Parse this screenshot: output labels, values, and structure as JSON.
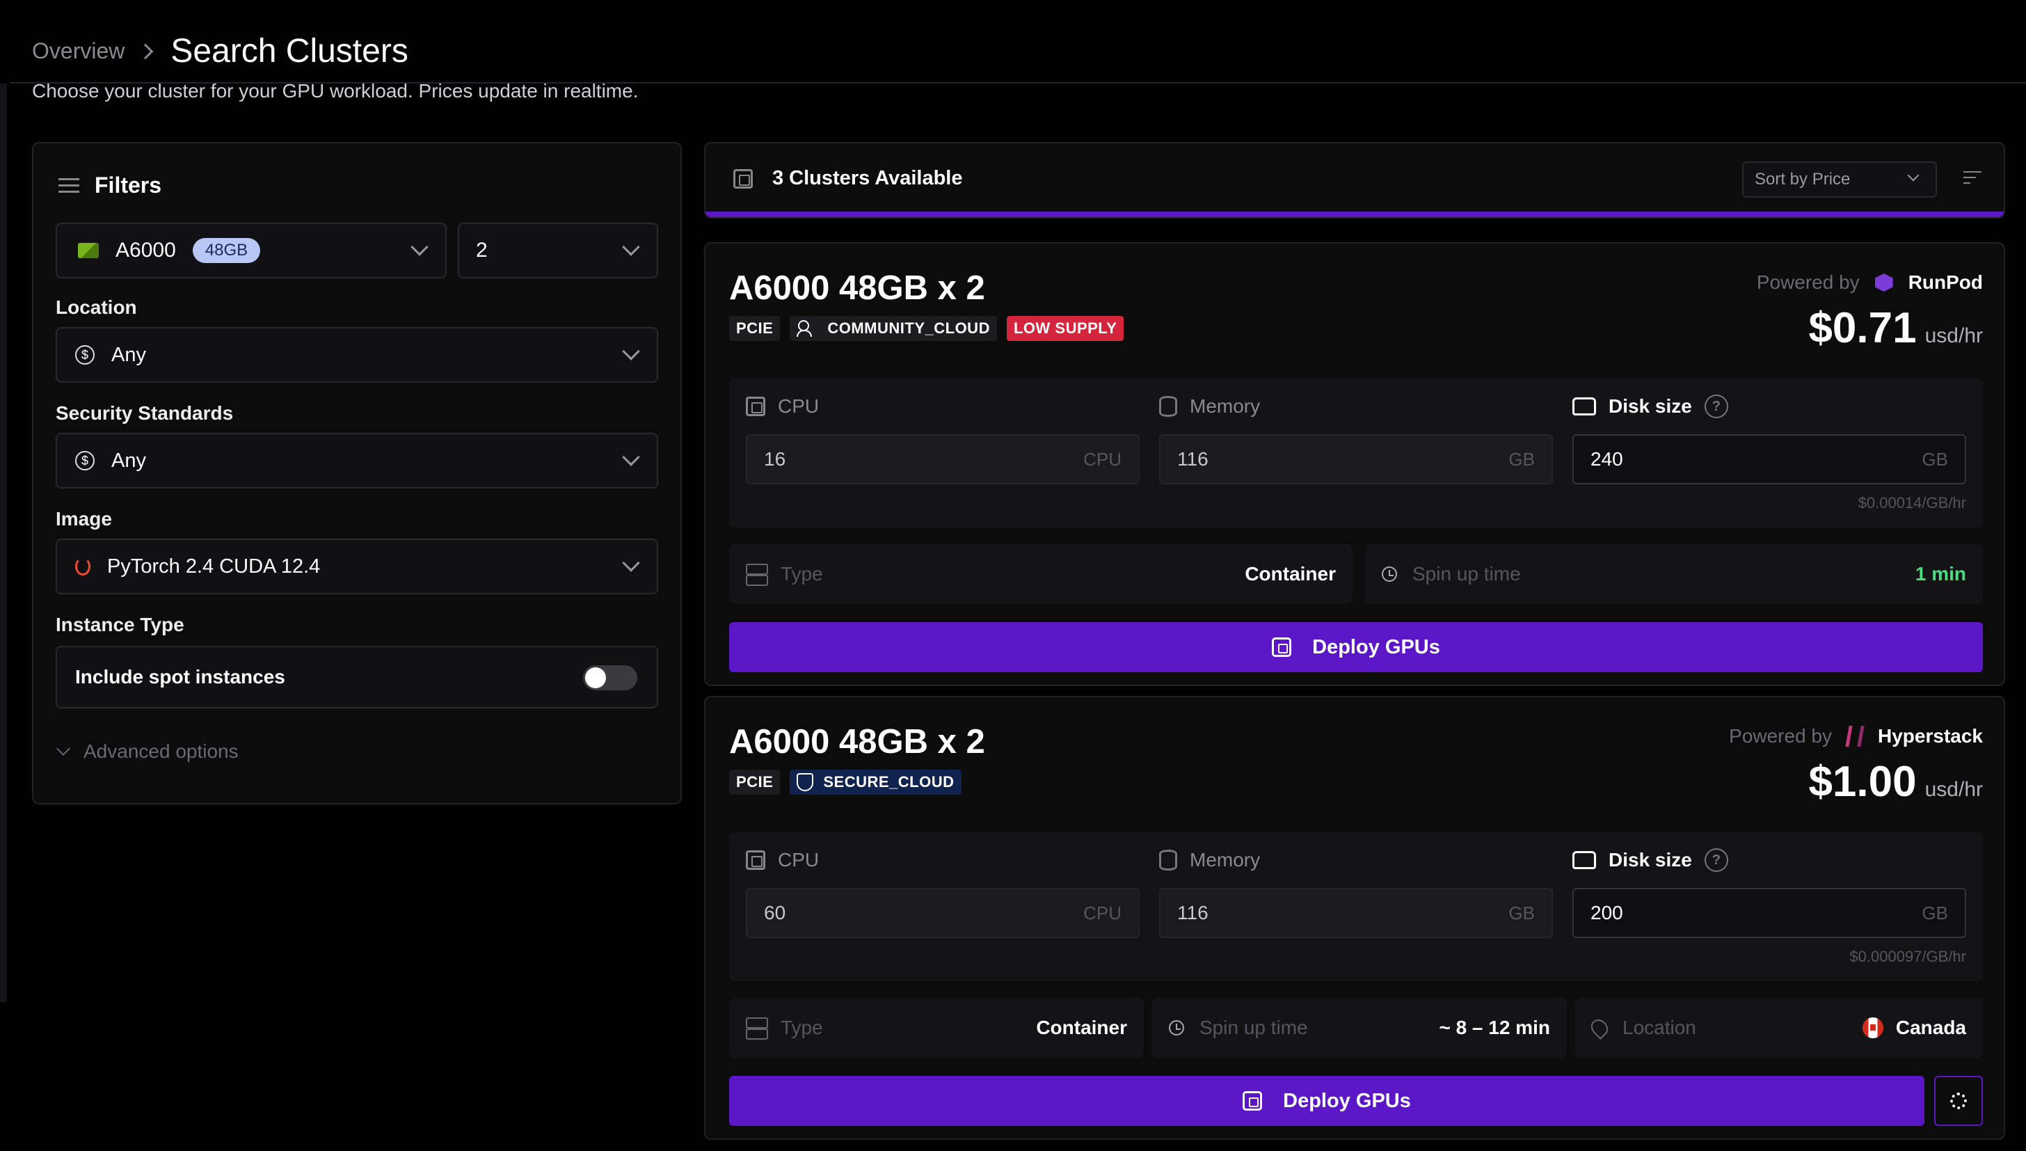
{
  "breadcrumb": {
    "parent": "Overview",
    "current": "Search Clusters"
  },
  "subtitle": "Choose your cluster for your GPU workload. Prices update in realtime.",
  "filters": {
    "title": "Filters",
    "gpu": {
      "name": "A6000",
      "memory_badge": "48GB"
    },
    "gpu_count": "2",
    "location": {
      "label": "Location",
      "value": "Any"
    },
    "security": {
      "label": "Security Standards",
      "value": "Any"
    },
    "image": {
      "label": "Image",
      "value": "PyTorch 2.4 CUDA 12.4"
    },
    "instance_type": {
      "label": "Instance Type",
      "toggle_label": "Include spot instances",
      "enabled": false
    },
    "advanced": "Advanced options"
  },
  "results": {
    "title": "3 Clusters Available",
    "sort": "Sort by Price"
  },
  "clusters": [
    {
      "title": "A6000 48GB x 2",
      "interface": "PCIE",
      "cloud": "COMMUNITY_CLOUD",
      "supply": "LOW SUPPLY",
      "powered_label": "Powered by",
      "provider": "RunPod",
      "price": "$0.71",
      "price_unit": "usd/hr",
      "cpu_label": "CPU",
      "cpu_value": "16",
      "cpu_unit": "CPU",
      "memory_label": "Memory",
      "memory_value": "116",
      "memory_unit": "GB",
      "disk_label": "Disk size",
      "disk_value": "240",
      "disk_unit": "GB",
      "disk_price": "$0.00014/GB/hr",
      "type_label": "Type",
      "type_value": "Container",
      "spin_label": "Spin up time",
      "spin_value": "1 min",
      "deploy": "Deploy GPUs",
      "accent_color": "#4ade80"
    },
    {
      "title": "A6000 48GB x 2",
      "interface": "PCIE",
      "cloud": "SECURE_CLOUD",
      "powered_label": "Powered by",
      "provider": "Hyperstack",
      "price": "$1.00",
      "price_unit": "usd/hr",
      "cpu_label": "CPU",
      "cpu_value": "60",
      "cpu_unit": "CPU",
      "memory_label": "Memory",
      "memory_value": "116",
      "memory_unit": "GB",
      "disk_label": "Disk size",
      "disk_value": "200",
      "disk_unit": "GB",
      "disk_price": "$0.000097/GB/hr",
      "type_label": "Type",
      "type_value": "Container",
      "spin_label": "Spin up time",
      "spin_value": "~ 8 – 12 min",
      "location_label": "Location",
      "location_value": "Canada",
      "deploy": "Deploy GPUs"
    }
  ],
  "colors": {
    "accent": "#5b17c7",
    "low_supply": "#d5253d",
    "secure": "#10224e"
  }
}
